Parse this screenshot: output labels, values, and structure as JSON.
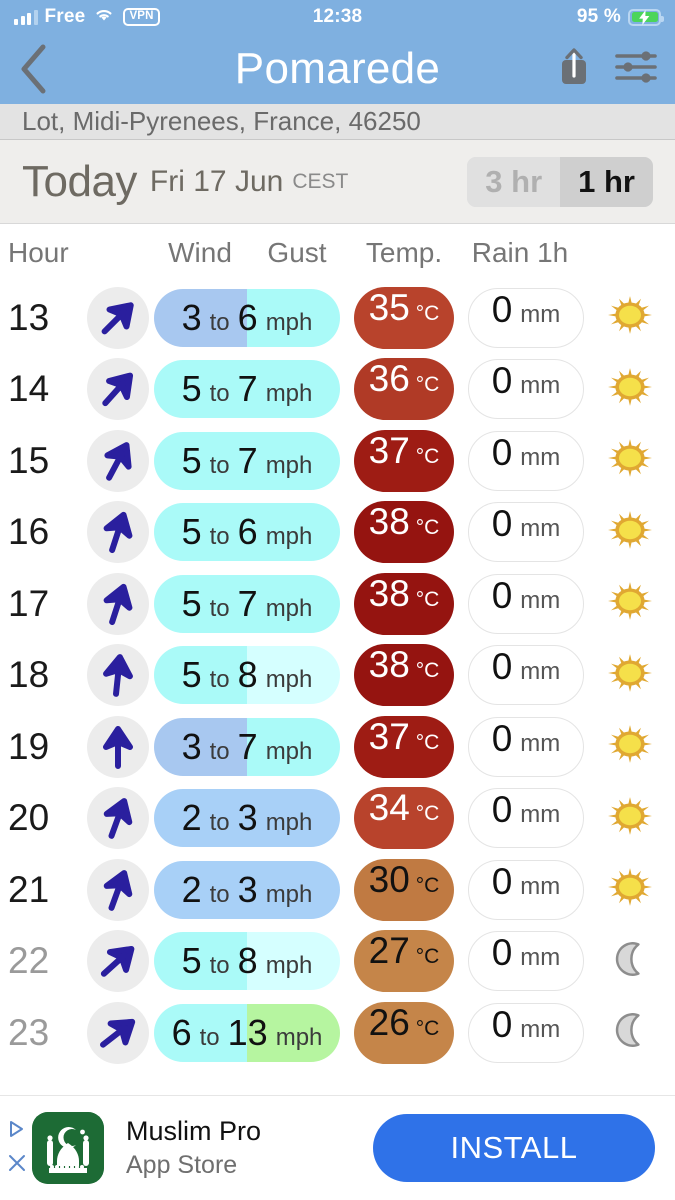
{
  "status_bar": {
    "carrier": "Free",
    "vpn": "VPN",
    "time": "12:38",
    "battery_percent": "95 %",
    "icons": [
      "signal-bars-icon",
      "wifi-icon",
      "vpn-badge",
      "battery-charging-icon"
    ]
  },
  "nav": {
    "back_icon": "chevron-left-icon",
    "title": "Pomarede",
    "share_icon": "share-icon",
    "settings_icon": "sliders-icon"
  },
  "subtitle": "Lot, Midi-Pyrenees, France, 46250",
  "day_header": {
    "today": "Today",
    "date": "Fri 17 Jun",
    "timezone": "CEST",
    "interval_options": [
      "3 hr",
      "1 hr"
    ],
    "interval_selected": "1 hr"
  },
  "columns": {
    "hour": "Hour",
    "wind": "Wind",
    "gust": "Gust",
    "temp": "Temp.",
    "rain": "Rain 1h"
  },
  "units": {
    "wind": "mph",
    "to": "to",
    "temp": "°C",
    "rain": "mm"
  },
  "colors": {
    "nav_bg": "#7fb0e0",
    "subtitle_bg": "#e3e3e3",
    "day_bg": "#efeeec",
    "arrow": "#2a1f9e",
    "arrow_bg": "#ececec",
    "sun_core": "#f5e04a",
    "sun_rays": "#e0a832",
    "moon": "#c6c6c6",
    "install_btn": "#2f72e8",
    "ad_icon_bg": "#1d6b35"
  },
  "rows": [
    {
      "hour": "13",
      "night": false,
      "dir_deg": 225,
      "wind": "3",
      "gust": "6",
      "wind_color": "#a8c8f0",
      "gust_color": "#aafaf8",
      "temp": "35",
      "temp_bg": "#b8432c",
      "temp_fg": "#ffffff",
      "rain": "0",
      "sky": "sun"
    },
    {
      "hour": "14",
      "night": false,
      "dir_deg": 222,
      "wind": "5",
      "gust": "7",
      "wind_color": "#aafaf8",
      "gust_color": "#aafaf8",
      "temp": "36",
      "temp_bg": "#b03a26",
      "temp_fg": "#ffffff",
      "rain": "0",
      "sky": "sun"
    },
    {
      "hour": "15",
      "night": false,
      "dir_deg": 208,
      "wind": "5",
      "gust": "7",
      "wind_color": "#aafaf8",
      "gust_color": "#aafaf8",
      "temp": "37",
      "temp_bg": "#9e1c14",
      "temp_fg": "#ffffff",
      "rain": "0",
      "sky": "sun"
    },
    {
      "hour": "16",
      "night": false,
      "dir_deg": 198,
      "wind": "5",
      "gust": "6",
      "wind_color": "#aafaf8",
      "gust_color": "#aafaf8",
      "temp": "38",
      "temp_bg": "#951410",
      "temp_fg": "#ffffff",
      "rain": "0",
      "sky": "sun"
    },
    {
      "hour": "17",
      "night": false,
      "dir_deg": 198,
      "wind": "5",
      "gust": "7",
      "wind_color": "#aafaf8",
      "gust_color": "#aafaf8",
      "temp": "38",
      "temp_bg": "#951410",
      "temp_fg": "#ffffff",
      "rain": "0",
      "sky": "sun"
    },
    {
      "hour": "18",
      "night": false,
      "dir_deg": 186,
      "wind": "5",
      "gust": "8",
      "wind_color": "#aafaf8",
      "gust_color": "#d5ffff",
      "temp": "38",
      "temp_bg": "#951410",
      "temp_fg": "#ffffff",
      "rain": "0",
      "sky": "sun"
    },
    {
      "hour": "19",
      "night": false,
      "dir_deg": 180,
      "wind": "3",
      "gust": "7",
      "wind_color": "#a8c8f0",
      "gust_color": "#aafaf8",
      "temp": "37",
      "temp_bg": "#9e1c14",
      "temp_fg": "#ffffff",
      "rain": "0",
      "sky": "sun"
    },
    {
      "hour": "20",
      "night": false,
      "dir_deg": 200,
      "wind": "2",
      "gust": "3",
      "wind_color": "#a8d0f7",
      "gust_color": "#a8d0f7",
      "temp": "34",
      "temp_bg": "#b8432c",
      "temp_fg": "#ffffff",
      "rain": "0",
      "sky": "sun"
    },
    {
      "hour": "21",
      "night": false,
      "dir_deg": 200,
      "wind": "2",
      "gust": "3",
      "wind_color": "#a8d0f7",
      "gust_color": "#a8d0f7",
      "temp": "30",
      "temp_bg": "#c07a42",
      "temp_fg": "#111111",
      "rain": "0",
      "sky": "sun"
    },
    {
      "hour": "22",
      "night": true,
      "dir_deg": 228,
      "wind": "5",
      "gust": "8",
      "wind_color": "#aafaf8",
      "gust_color": "#d5ffff",
      "temp": "27",
      "temp_bg": "#c58549",
      "temp_fg": "#111111",
      "rain": "0",
      "sky": "moon"
    },
    {
      "hour": "23",
      "night": true,
      "dir_deg": 232,
      "wind": "6",
      "gust": "13",
      "wind_color": "#aafaf8",
      "gust_color": "#b6f5a0",
      "temp": "26",
      "temp_bg": "#c58549",
      "temp_fg": "#111111",
      "rain": "0",
      "sky": "moon"
    }
  ],
  "ad": {
    "title": "Muslim Pro",
    "subtitle": "App Store",
    "install_label": "INSTALL",
    "adchoices_icon": "adchoices-triangle-icon",
    "close_icon": "close-icon",
    "app_icon": "mosque-icon"
  }
}
